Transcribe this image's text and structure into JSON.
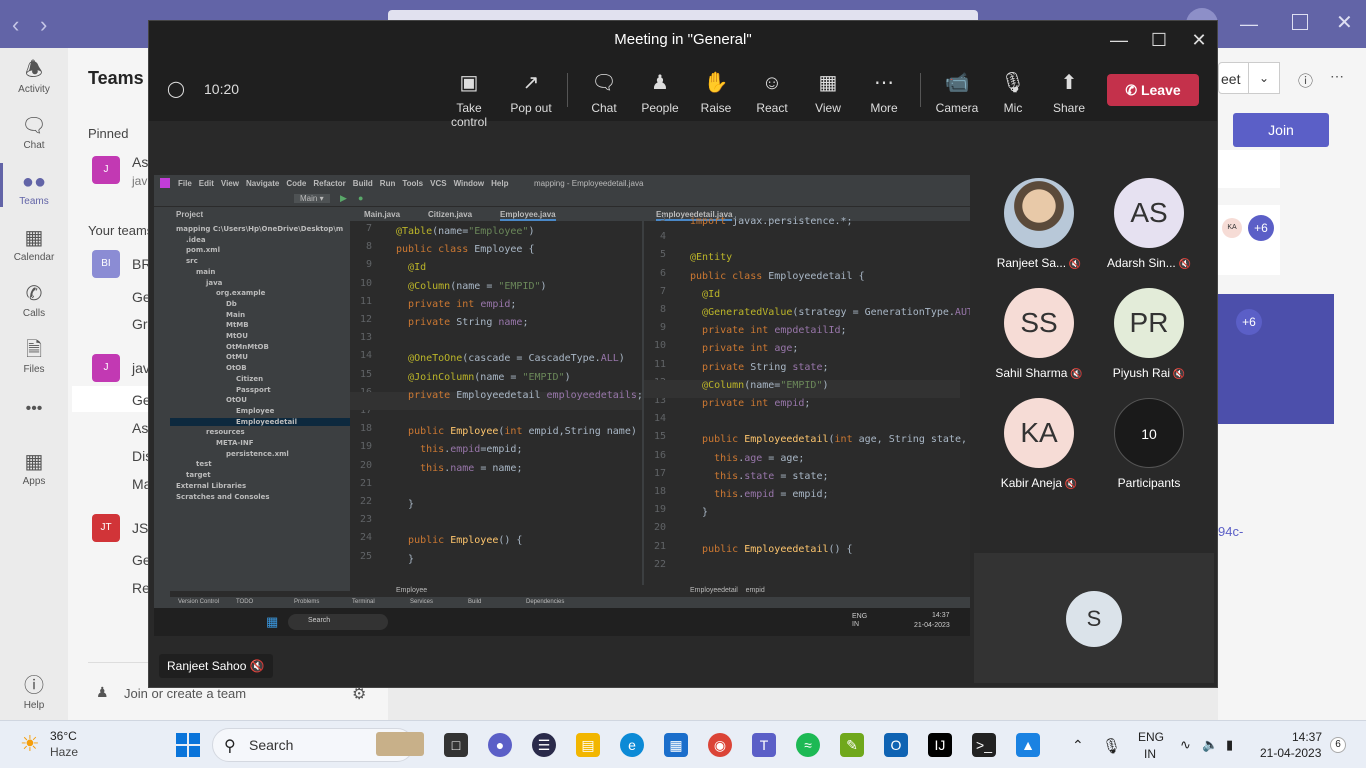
{
  "rail": {
    "items": [
      {
        "label": "Activity"
      },
      {
        "label": "Chat"
      },
      {
        "label": "Teams"
      },
      {
        "label": "Calendar"
      },
      {
        "label": "Calls"
      },
      {
        "label": "Files"
      },
      {
        "label": "Apps"
      },
      {
        "label": "Help"
      }
    ]
  },
  "teams_panel": {
    "heading": "Teams",
    "pinned": "Pinned",
    "your_teams": "Your teams",
    "items": [
      "As",
      "jav",
      "BR",
      "Ge",
      "Gr",
      "jav",
      "Ge",
      "As",
      "Dis",
      "Ma",
      "JS",
      "Ge",
      "Re"
    ],
    "avatars": [
      "J",
      "BI",
      "J",
      "JT"
    ],
    "join_create": "Join or create a team"
  },
  "right_panel": {
    "meet": "eet",
    "join": "Join",
    "ka": "KA",
    "plus6": "+6",
    "link": "94c-"
  },
  "meeting": {
    "title": "Meeting in \"General\"",
    "timer": "10:20",
    "toolbar": [
      "Take control",
      "Pop out",
      "Chat",
      "People",
      "Raise",
      "React",
      "View",
      "More",
      "Camera",
      "Mic",
      "Share"
    ],
    "leave": "Leave",
    "presenter": "Ranjeet Sahoo"
  },
  "participants": [
    {
      "name": "Ranjeet Sa...",
      "initials": "",
      "color": "#c8a070"
    },
    {
      "name": "Adarsh Sin...",
      "initials": "AS",
      "color": "#e6e1f1"
    },
    {
      "name": "Sahil Sharma",
      "initials": "SS",
      "color": "#f6dcd6"
    },
    {
      "name": "Piyush Rai",
      "initials": "PR",
      "color": "#e3ecd9"
    },
    {
      "name": "Kabir Aneja",
      "initials": "KA",
      "color": "#f6dcd6"
    },
    {
      "name": "Participants",
      "initials": "10",
      "color": "#1a1a1a"
    }
  ],
  "self_tile": "S",
  "ide": {
    "menu": [
      "File",
      "Edit",
      "View",
      "Navigate",
      "Code",
      "Refactor",
      "Build",
      "Run",
      "Tools",
      "VCS",
      "Window",
      "Help"
    ],
    "window_title": "mapping - Employeedetail.java",
    "tabs_left": [
      "Main.java",
      "Citizen.java",
      "Employee.java"
    ],
    "tab_right": "Employeedetail.java",
    "project_label": "Project",
    "tree": [
      {
        "t": "mapping C:\\Users\\Hp\\OneDrive\\Desktop\\m",
        "d": 0
      },
      {
        "t": ".idea",
        "d": 1
      },
      {
        "t": "pom.xml",
        "d": 1
      },
      {
        "t": "src",
        "d": 1
      },
      {
        "t": "main",
        "d": 2
      },
      {
        "t": "java",
        "d": 3
      },
      {
        "t": "org.example",
        "d": 4
      },
      {
        "t": "Db",
        "d": 5
      },
      {
        "t": "Main",
        "d": 5
      },
      {
        "t": "MtMB",
        "d": 5
      },
      {
        "t": "MtOU",
        "d": 5
      },
      {
        "t": "OtMnMtOB",
        "d": 5
      },
      {
        "t": "OtMU",
        "d": 5
      },
      {
        "t": "OtOB",
        "d": 5
      },
      {
        "t": "Citizen",
        "d": 6
      },
      {
        "t": "Passport",
        "d": 6
      },
      {
        "t": "OtOU",
        "d": 5
      },
      {
        "t": "Employee",
        "d": 6
      },
      {
        "t": "Employeedetail",
        "d": 6
      },
      {
        "t": "resources",
        "d": 3
      },
      {
        "t": "META-INF",
        "d": 4
      },
      {
        "t": "persistence.xml",
        "d": 5
      },
      {
        "t": "test",
        "d": 2
      },
      {
        "t": "target",
        "d": 1
      },
      {
        "t": "External Libraries",
        "d": 0
      },
      {
        "t": "Scratches and Consoles",
        "d": 0
      }
    ],
    "left_lines": [
      "7",
      "8",
      "9",
      "10",
      "11",
      "12",
      "13",
      "14",
      "15",
      "16",
      "17",
      "18",
      "19",
      "20",
      "21",
      "22",
      "23",
      "24",
      "25"
    ],
    "right_lines": [
      "3",
      "4",
      "5",
      "6",
      "7",
      "8",
      "9",
      "10",
      "11",
      "12",
      "13",
      "14",
      "15",
      "16",
      "17",
      "18",
      "19",
      "20",
      "21",
      "22"
    ],
    "crumb_left": "Employee",
    "crumb_right": "Employeedetail    empid",
    "status": [
      "Version Control",
      "TODO",
      "Problems",
      "Terminal",
      "Services",
      "Build",
      "Dependencies"
    ],
    "inner_search": "Search",
    "inner_lang": "ENG\nIN",
    "inner_time": "14:37",
    "inner_date": "21-04-2023"
  },
  "taskbar": {
    "weather_temp": "36°C",
    "weather_desc": "Haze",
    "search": "Search",
    "lang1": "ENG",
    "lang2": "IN",
    "time": "14:37",
    "date": "21-04-2023",
    "badge": "6"
  }
}
